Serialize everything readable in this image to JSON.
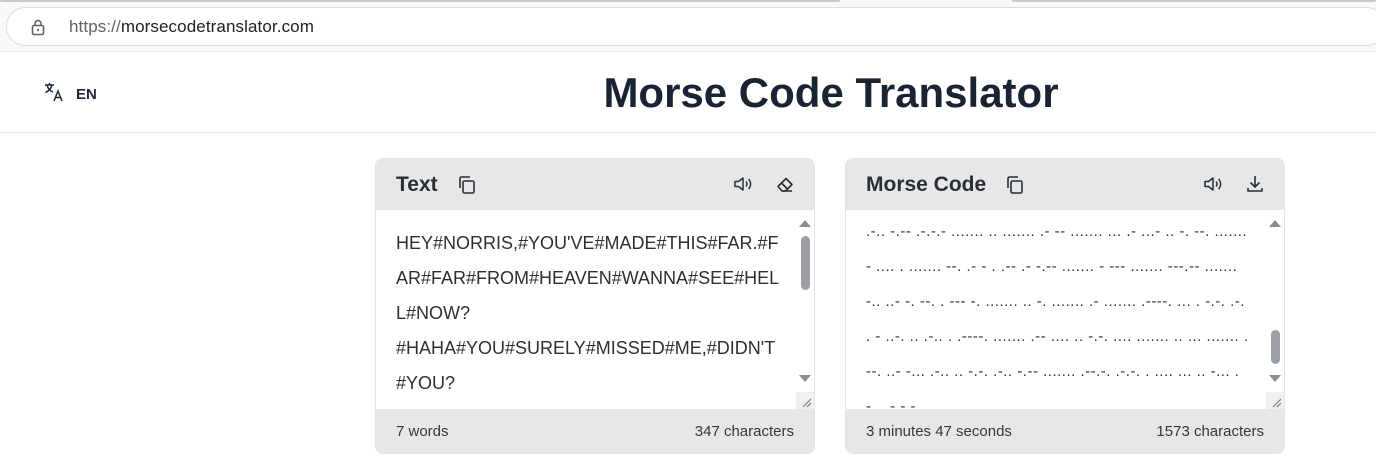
{
  "browser": {
    "url_scheme": "https://",
    "url_host": "morsecodetranslator.com",
    "lock_icon": "lock-icon"
  },
  "header": {
    "language_code": "EN",
    "language_icon": "translate-icon",
    "title": "Morse Code Translator"
  },
  "text_panel": {
    "title": "Text",
    "content": "HEY#NORRIS,#YOU'VE#MADE#THIS#FAR.#FAR#FAR#FROM#HEAVEN#WANNA#SEE#HELL#NOW?\n#HAHA#YOU#SURELY#MISSED#ME,#DIDN'T#YOU?\n#OH#DAMN#MY#BATTERY#IS#ABOUT#TO#",
    "words": "7 words",
    "characters": "347 characters",
    "icons": [
      "copy-icon",
      "speaker-icon",
      "eraser-icon"
    ]
  },
  "morse_panel": {
    "title": "Morse Code",
    "content": ".-.. -.-- .-.-.- ....... .. ....... .- -- ....... ... .- ...- .. -. --. ....... - .... . ....... --. .- - . .-- .- -.-- ....... - --- ....... ---.-- ....... -.. ..- -. --. . --- -. ....... .. -. ....... .- ....... .----. ... . -.-. .-. . - ..-. .. .-.. . .----. ....... .-- .... .. -.-. .... ....... .. ... ....... .--. ..- -... .-.. .. -.-. .-.. -.-- ....... .--.-. .-.-. . .... ... .. -... .-.. .-.-.-",
    "duration": "3 minutes 47 seconds",
    "characters": "1573 characters",
    "icons": [
      "copy-icon",
      "speaker-icon",
      "download-icon"
    ]
  }
}
